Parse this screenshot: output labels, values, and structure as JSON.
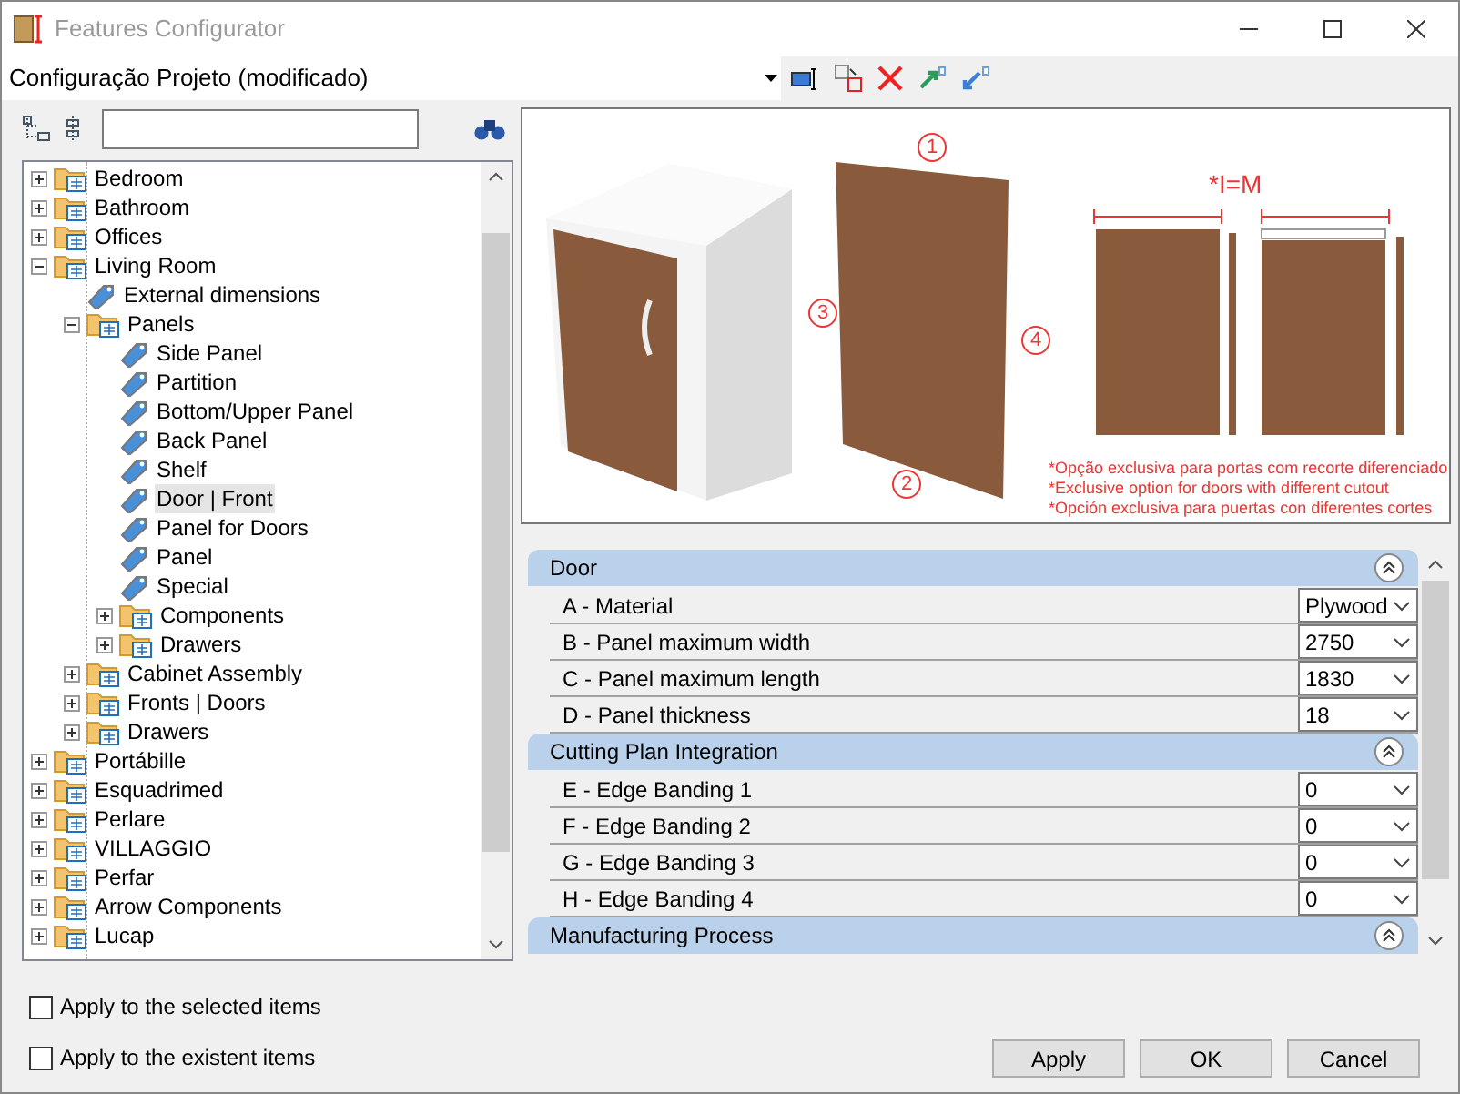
{
  "window": {
    "title": "Features Configurator"
  },
  "configuration": {
    "value": "Configuração Projeto (modificado)"
  },
  "tree": [
    {
      "kind": "folder",
      "label": "Bedroom",
      "expanded": false,
      "selected": false
    },
    {
      "kind": "folder",
      "label": "Bathroom",
      "expanded": false,
      "selected": false
    },
    {
      "kind": "folder",
      "label": "Offices",
      "expanded": false,
      "selected": false
    },
    {
      "kind": "folder",
      "label": "Living Room",
      "expanded": true,
      "selected": false,
      "children": [
        {
          "kind": "feature",
          "label": "External dimensions",
          "selected": false
        },
        {
          "kind": "folder",
          "label": "Panels",
          "expanded": true,
          "selected": false,
          "children": [
            {
              "kind": "feature",
              "label": "Side Panel",
              "selected": false
            },
            {
              "kind": "feature",
              "label": "Partition",
              "selected": false
            },
            {
              "kind": "feature",
              "label": "Bottom/Upper Panel",
              "selected": false
            },
            {
              "kind": "feature",
              "label": "Back Panel",
              "selected": false
            },
            {
              "kind": "feature",
              "label": "Shelf",
              "selected": false
            },
            {
              "kind": "feature",
              "label": "Door | Front",
              "selected": true
            },
            {
              "kind": "feature",
              "label": "Panel for Doors",
              "selected": false
            },
            {
              "kind": "feature",
              "label": "Panel",
              "selected": false
            },
            {
              "kind": "feature",
              "label": "Special",
              "selected": false
            },
            {
              "kind": "folder",
              "label": "Components",
              "expanded": false,
              "selected": false
            },
            {
              "kind": "folder",
              "label": "Drawers",
              "expanded": false,
              "selected": false
            }
          ]
        },
        {
          "kind": "folder",
          "label": "Cabinet Assembly",
          "expanded": false,
          "selected": false
        },
        {
          "kind": "folder",
          "label": "Fronts | Doors",
          "expanded": false,
          "selected": false
        },
        {
          "kind": "folder",
          "label": "Drawers",
          "expanded": false,
          "selected": false
        }
      ]
    },
    {
      "kind": "folder",
      "label": "Portábille",
      "expanded": false,
      "selected": false
    },
    {
      "kind": "folder",
      "label": "Esquadrimed",
      "expanded": false,
      "selected": false
    },
    {
      "kind": "folder",
      "label": "Perlare",
      "expanded": false,
      "selected": false
    },
    {
      "kind": "folder",
      "label": "VILLAGGIO",
      "expanded": false,
      "selected": false
    },
    {
      "kind": "folder",
      "label": "Perfar",
      "expanded": false,
      "selected": false
    },
    {
      "kind": "folder",
      "label": "Arrow Components",
      "expanded": false,
      "selected": false
    },
    {
      "kind": "folder",
      "label": "Lucap",
      "expanded": false,
      "selected": false
    }
  ],
  "preview": {
    "edge_numbers": [
      "1",
      "2",
      "3",
      "4"
    ],
    "formula": "*I=M",
    "notes": [
      "*Opção exclusiva para portas com recorte diferenciado",
      "*Exclusive option for doors with different cutout",
      "*Opción exclusiva para puertas con diferentes cortes"
    ]
  },
  "sections": [
    {
      "title": "Door",
      "expanded": true,
      "rows": [
        {
          "label": "A - Material",
          "value": "Plywood"
        },
        {
          "label": "B - Panel maximum width",
          "value": "2750"
        },
        {
          "label": "C - Panel maximum length",
          "value": "1830"
        },
        {
          "label": "D - Panel thickness",
          "value": "18"
        }
      ]
    },
    {
      "title": "Cutting Plan Integration",
      "expanded": true,
      "rows": [
        {
          "label": "E - Edge Banding 1",
          "value": "0"
        },
        {
          "label": "F - Edge Banding 2",
          "value": "0"
        },
        {
          "label": "G - Edge Banding 3",
          "value": "0"
        },
        {
          "label": "H - Edge Banding 4",
          "value": "0"
        }
      ]
    },
    {
      "title": "Manufacturing Process",
      "expanded": true
    }
  ],
  "options": [
    {
      "label": "Apply to the selected items",
      "checked": false
    },
    {
      "label": "Apply to the existent items",
      "checked": false
    }
  ],
  "buttons": [
    "Apply",
    "OK",
    "Cancel"
  ]
}
